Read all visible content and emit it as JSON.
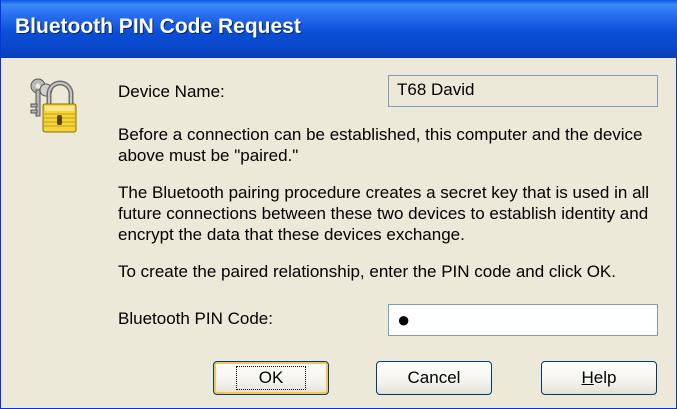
{
  "dialog": {
    "title": "Bluetooth PIN Code Request"
  },
  "icon": "lock-with-keys-icon",
  "device": {
    "label": "Device Name:",
    "value": "T68 David"
  },
  "paragraphs": {
    "p1_line1": "Before a connection can be established, this computer and the device",
    "p1_line2": "above must be \"paired.\"",
    "p2_line1": "The Bluetooth pairing procedure creates a secret key that is used in all",
    "p2_line2": "future connections between these two devices to establish identity and",
    "p2_line3": "encrypt the data that these devices exchange.",
    "p3": "To create the paired relationship, enter the PIN code and click OK."
  },
  "pin": {
    "label": "Bluetooth PIN Code:",
    "value": "●"
  },
  "buttons": {
    "ok": "OK",
    "cancel": "Cancel",
    "help_mnemonic": "H",
    "help_rest": "elp"
  }
}
